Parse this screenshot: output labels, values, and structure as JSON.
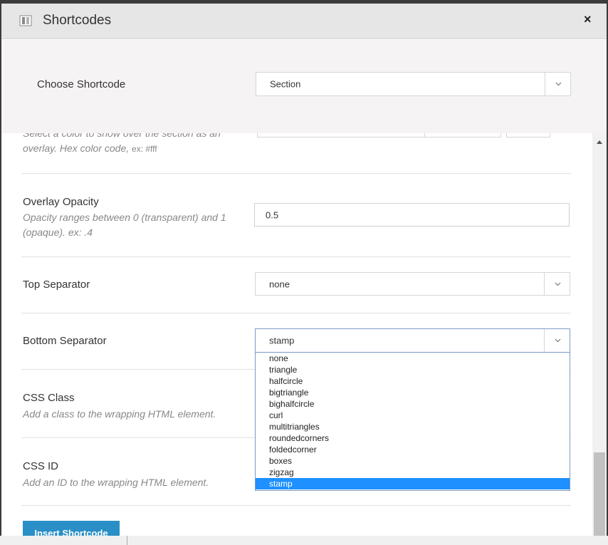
{
  "modal": {
    "title": "Shortcodes",
    "close_symbol": "×",
    "header_icon": "shortcode-icon"
  },
  "choose": {
    "label": "Choose Shortcode",
    "selected": "Section"
  },
  "fields": {
    "overlay_color": {
      "desc_line1": "Select a color to show over the section as an",
      "desc_line2": "overlay. Hex color code,",
      "desc_example": "ex: #fff"
    },
    "overlay_opacity": {
      "label": "Overlay Opacity",
      "desc_line1": "Opacity ranges between 0 (transparent) and 1",
      "desc_line2": "(opaque). ex: .4",
      "value": "0.5"
    },
    "top_separator": {
      "label": "Top Separator",
      "value": "none"
    },
    "bottom_separator": {
      "label": "Bottom Separator",
      "value": "stamp",
      "options": [
        "none",
        "triangle",
        "halfcircle",
        "bigtriangle",
        "bighalfcircle",
        "curl",
        "multitriangles",
        "roundedcorners",
        "foldedcorner",
        "boxes",
        "zigzag",
        "stamp"
      ]
    },
    "css_class": {
      "label": "CSS Class",
      "desc": "Add a class to the wrapping HTML element."
    },
    "css_id": {
      "label": "CSS ID",
      "desc": "Add an ID to the wrapping HTML element."
    }
  },
  "insert_button": "Insert Shortcode"
}
